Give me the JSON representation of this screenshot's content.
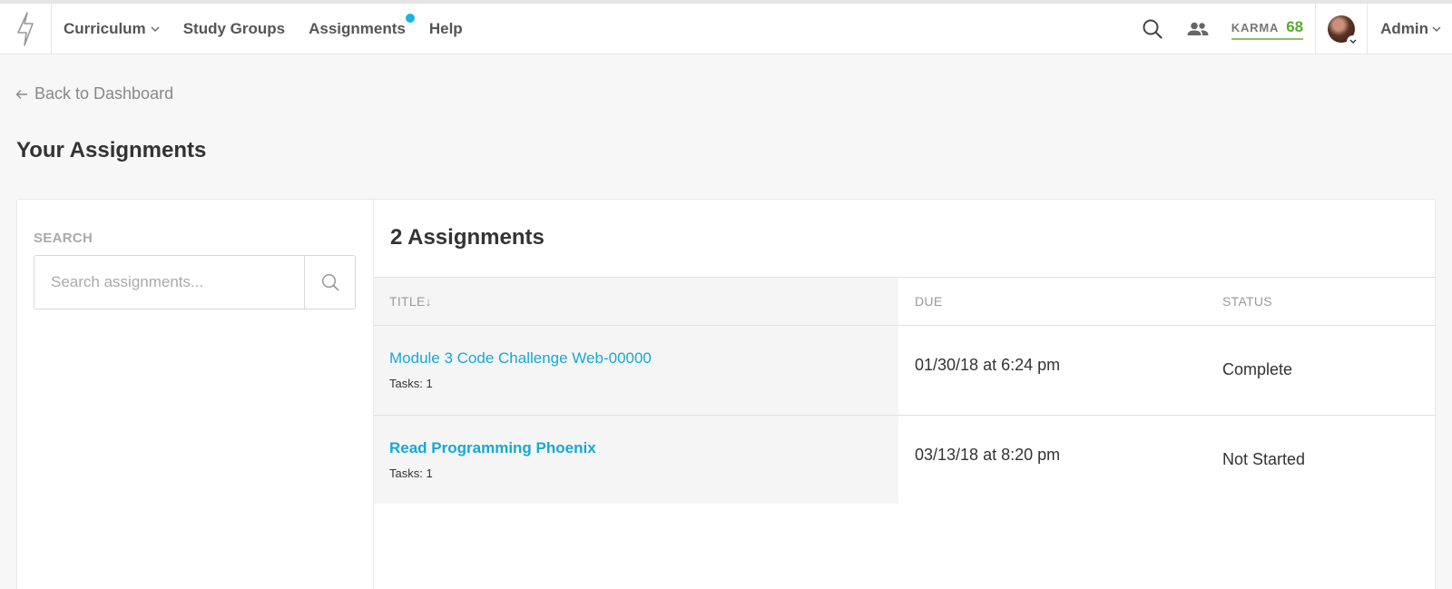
{
  "nav": {
    "links": {
      "curriculum": "Curriculum",
      "study_groups": "Study Groups",
      "assignments": "Assignments",
      "help": "Help"
    },
    "karma_label": "KARMA",
    "karma_value": "68",
    "admin_label": "Admin"
  },
  "back_link": "Back to Dashboard",
  "page_title": "Your Assignments",
  "sidebar": {
    "search_label": "SEARCH",
    "search_placeholder": "Search assignments..."
  },
  "main": {
    "count_title": "2 Assignments",
    "columns": {
      "title": "TITLE↓",
      "due": "DUE",
      "status": "STATUS"
    },
    "rows": [
      {
        "title": "Module 3 Code Challenge Web-00000",
        "tasks": "Tasks: 1",
        "due": "01/30/18 at 6:24 pm",
        "status": "Complete"
      },
      {
        "title": "Read Programming Phoenix",
        "tasks": "Tasks: 1",
        "due": "03/13/18 at 8:20 pm",
        "status": "Not Started"
      }
    ]
  },
  "colors": {
    "accent": "#17a8d4",
    "notification_dot": "#17b4e0",
    "karma": "#5aab30"
  }
}
